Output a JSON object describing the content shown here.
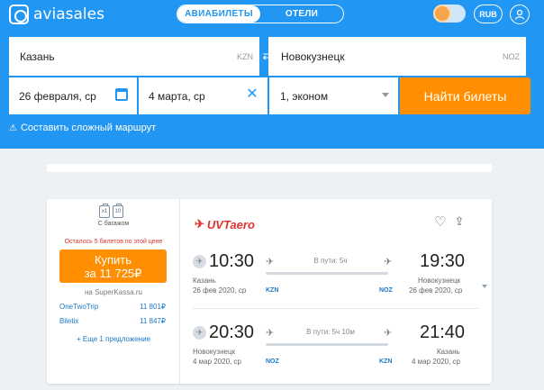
{
  "header": {
    "logo_text": "aviasales",
    "tabs": [
      {
        "label": "АВИАБИЛЕТЫ",
        "active": true
      },
      {
        "label": "ОТЕЛИ",
        "active": false
      }
    ],
    "currency": "RUB",
    "accent_color": "#2196f3"
  },
  "search": {
    "from_city": "Казань",
    "from_code": "KZN",
    "to_city": "Новокузнецк",
    "to_code": "NOZ",
    "depart_date": "26 февраля, ср",
    "return_date": "4 марта, ср",
    "passengers": "1, эконом",
    "search_button": "Найти билеты",
    "complex_route": "Составить сложный маршрут"
  },
  "result": {
    "baggage_label": "С багажом",
    "bag_icons": [
      "x1",
      "10"
    ],
    "tickets_left": "Осталось 5 билетов по этой цене",
    "buy_label": "Купить",
    "buy_price": "за 11 725₽",
    "seller": "на SuperKassa.ru",
    "offers": [
      {
        "agency": "OneTwoTrip",
        "price": "11 801₽"
      },
      {
        "agency": "Biletix",
        "price": "11 847₽"
      }
    ],
    "more_offers": "+ Еще 1 предложение",
    "airline": "UVTaero",
    "segments": [
      {
        "dep_time": "10:30",
        "dep_city": "Казань",
        "dep_date": "26 фев 2020, ср",
        "dep_code": "KZN",
        "duration": "В пути: 5ч",
        "arr_time": "19:30",
        "arr_city": "Новокузнецк",
        "arr_date": "26 фев 2020, ср",
        "arr_code": "NOZ"
      },
      {
        "dep_time": "20:30",
        "dep_city": "Новокузнецк",
        "dep_date": "4 мар 2020, ср",
        "dep_code": "NOZ",
        "duration": "В пути: 5ч 10м",
        "arr_time": "21:40",
        "arr_city": "Казань",
        "arr_date": "4 мар 2020, ср",
        "arr_code": "KZN"
      }
    ],
    "buy_color": "#ff8e00"
  }
}
